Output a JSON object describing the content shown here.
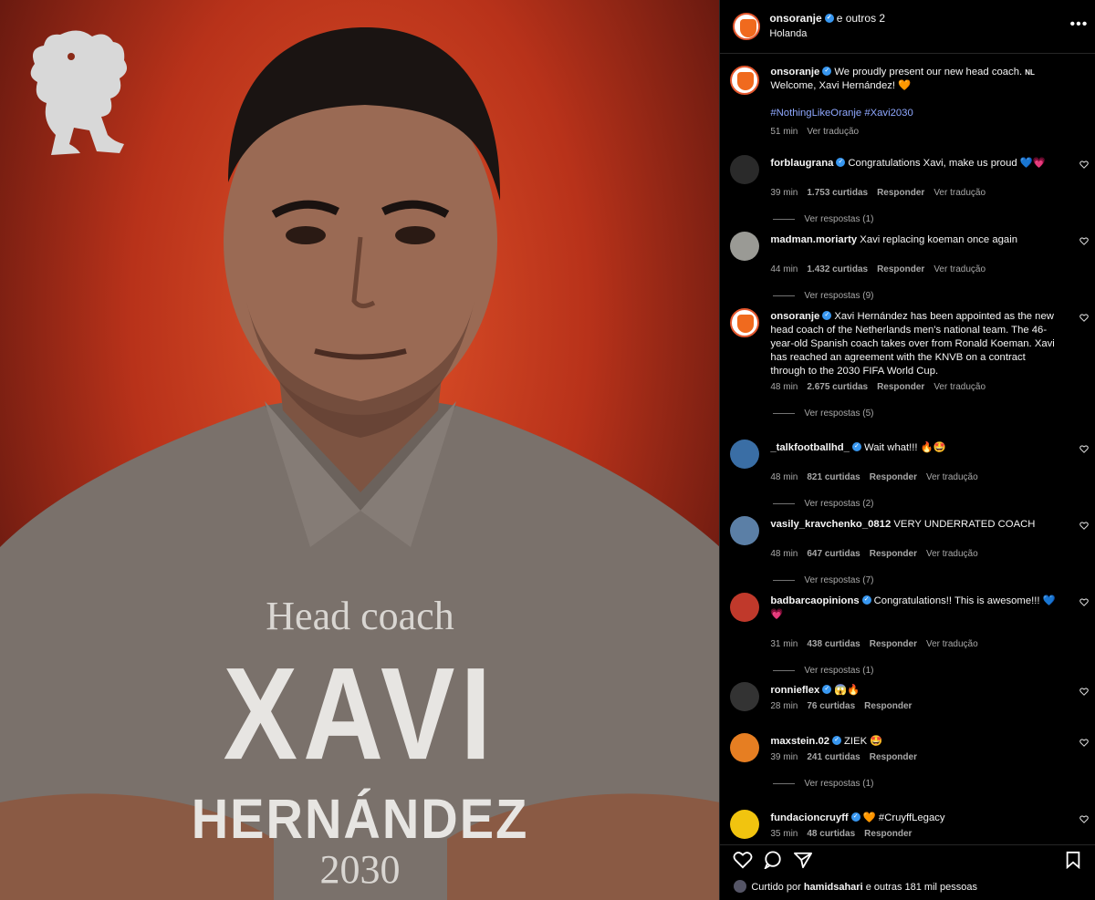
{
  "poster": {
    "subtitle": "Head coach",
    "first_name": "XAVI",
    "last_name": "HERNÁNDEZ",
    "year": "2030"
  },
  "header": {
    "username": "onsoranje",
    "others": "e outros 2",
    "location": "Holanda",
    "more": "•••"
  },
  "caption": {
    "username": "onsoranje",
    "text": "We proudly present our new head coach.",
    "flag": "NL",
    "text2": "Welcome, Xavi Hernández! 🧡",
    "hashtags": "#NothingLikeOranje #Xavi2030",
    "time": "51 min",
    "translate": "Ver tradução"
  },
  "comments": [
    {
      "username": "forblaugrana",
      "verified": true,
      "text": "Congratulations Xavi, make us proud 💙💗",
      "time": "39 min",
      "likes": "1.753 curtidas",
      "reply": "Responder",
      "translate": "Ver tradução",
      "replies": "Ver respostas (1)",
      "avatar_color": "#2a2a2a"
    },
    {
      "username": "madman.moriarty",
      "verified": false,
      "text": "Xavi replacing koeman once again",
      "time": "44 min",
      "likes": "1.432 curtidas",
      "reply": "Responder",
      "translate": "Ver tradução",
      "replies": "Ver respostas (9)",
      "avatar_color": "#9a9a95"
    },
    {
      "username": "onsoranje",
      "verified": true,
      "text": "Xavi Hernández has been appointed as the new head coach of the Netherlands men's national team. The 46-year-old Spanish coach takes over from Ronald Koeman. Xavi has reached an agreement with the KNVB on a contract through to the 2030 FIFA World Cup.",
      "time": "48 min",
      "likes": "2.675 curtidas",
      "reply": "Responder",
      "translate": "Ver tradução",
      "replies": "Ver respostas (5)",
      "avatar_color": "#ffffff"
    },
    {
      "username": "_talkfootballhd_",
      "verified": true,
      "text": "Wait what!!! 🔥🤩",
      "time": "48 min",
      "likes": "821 curtidas",
      "reply": "Responder",
      "translate": "Ver tradução",
      "replies": "Ver respostas (2)",
      "avatar_color": "#3a6ea5"
    },
    {
      "username": "vasily_kravchenko_0812",
      "verified": false,
      "text": "VERY UNDERRATED COACH",
      "time": "48 min",
      "likes": "647 curtidas",
      "reply": "Responder",
      "translate": "Ver tradução",
      "replies": "Ver respostas (7)",
      "avatar_color": "#5b7fa6"
    },
    {
      "username": "badbarcaopinions",
      "verified": true,
      "text": "Congratulations!! This is awesome!!! 💙💗",
      "time": "31 min",
      "likes": "438 curtidas",
      "reply": "Responder",
      "translate": "Ver tradução",
      "replies": "Ver respostas (1)",
      "avatar_color": "#c0392b"
    },
    {
      "username": "ronnieflex",
      "verified": true,
      "text": "😱🔥",
      "time": "28 min",
      "likes": "76 curtidas",
      "reply": "Responder",
      "translate": "",
      "replies": "",
      "avatar_color": "#333333"
    },
    {
      "username": "maxstein.02",
      "verified": true,
      "text": "ZIEK 🤩",
      "time": "39 min",
      "likes": "241 curtidas",
      "reply": "Responder",
      "translate": "",
      "replies": "Ver respostas (1)",
      "avatar_color": "#e67e22"
    },
    {
      "username": "fundacioncruyff",
      "verified": true,
      "text": "🧡 #CruyffLegacy",
      "time": "35 min",
      "likes": "48 curtidas",
      "reply": "Responder",
      "translate": "",
      "replies": "",
      "avatar_color": "#f1c40f"
    }
  ],
  "likes_line": {
    "prefix": "Curtido por",
    "user": "hamidsahari",
    "suffix": "e outras 181 mil pessoas"
  },
  "icons": {
    "like": "heart-icon",
    "comment": "comment-icon",
    "share": "share-icon",
    "save": "bookmark-icon"
  }
}
